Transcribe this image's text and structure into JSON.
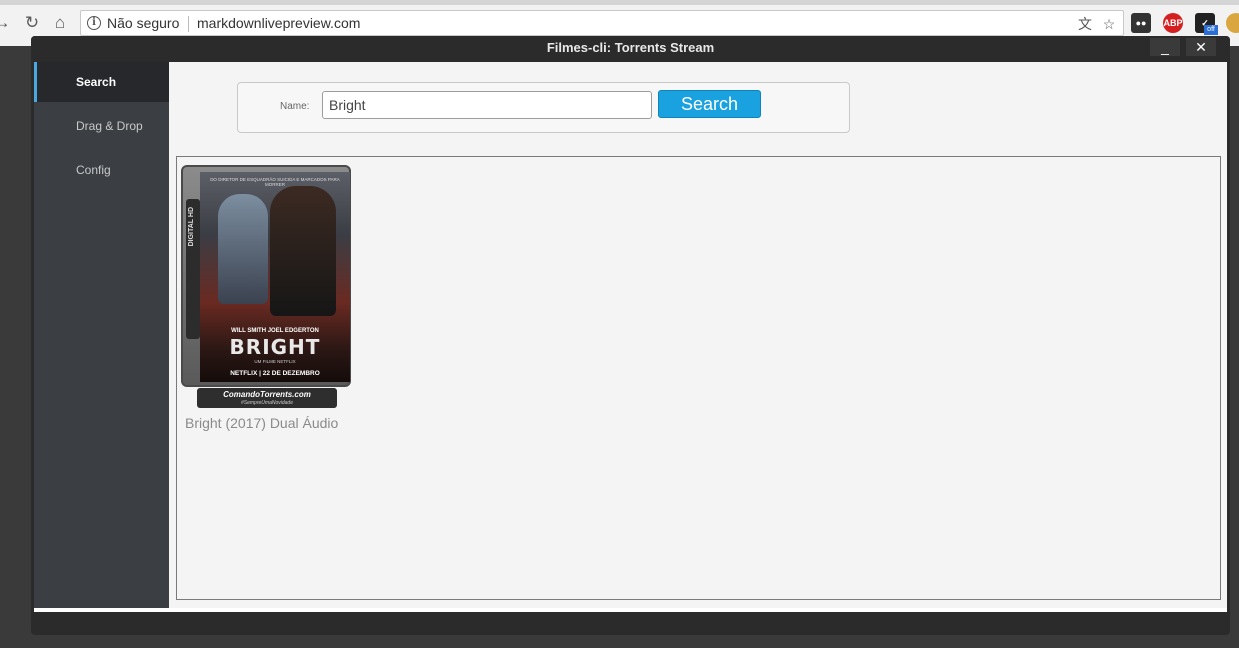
{
  "browser": {
    "back_icon": "back-arrow-icon",
    "reload_icon": "reload-icon",
    "home_icon": "home-icon",
    "security_label": "Não seguro",
    "url": "markdownlivepreview.com",
    "extensions": [
      "adblock-plus",
      "ghostery",
      "cookie"
    ],
    "abp_label": "ABP",
    "off_badge": "off"
  },
  "app": {
    "title": "Filmes-cli: Torrents Stream",
    "minimize_label": "_",
    "close_label": "✕"
  },
  "sidebar": {
    "items": [
      {
        "label": "Search",
        "active": true
      },
      {
        "label": "Drag & Drop",
        "active": false
      },
      {
        "label": "Config",
        "active": false
      }
    ]
  },
  "search": {
    "name_label": "Name:",
    "query": "Bright",
    "button_label": "Search",
    "button_color": "#1aa1e0"
  },
  "results": [
    {
      "title": "Bright (2017) Dual Áudio",
      "poster": {
        "tagline": "DO DIRETOR DE ESQUADRÃO SUICIDA E MARCADOS PARA MORRER",
        "cast": "WILL SMITH   JOEL EDGERTON",
        "title": "BRIGHT",
        "subtitle": "UM FILME NETFLIX",
        "release": "NETFLIX  |  22 DE DEZEMBRO",
        "spine": "DIGITAL HD",
        "brand": "ComandoTorrents.com",
        "brand_sub": "#SempreUmaNovidade"
      }
    }
  ]
}
